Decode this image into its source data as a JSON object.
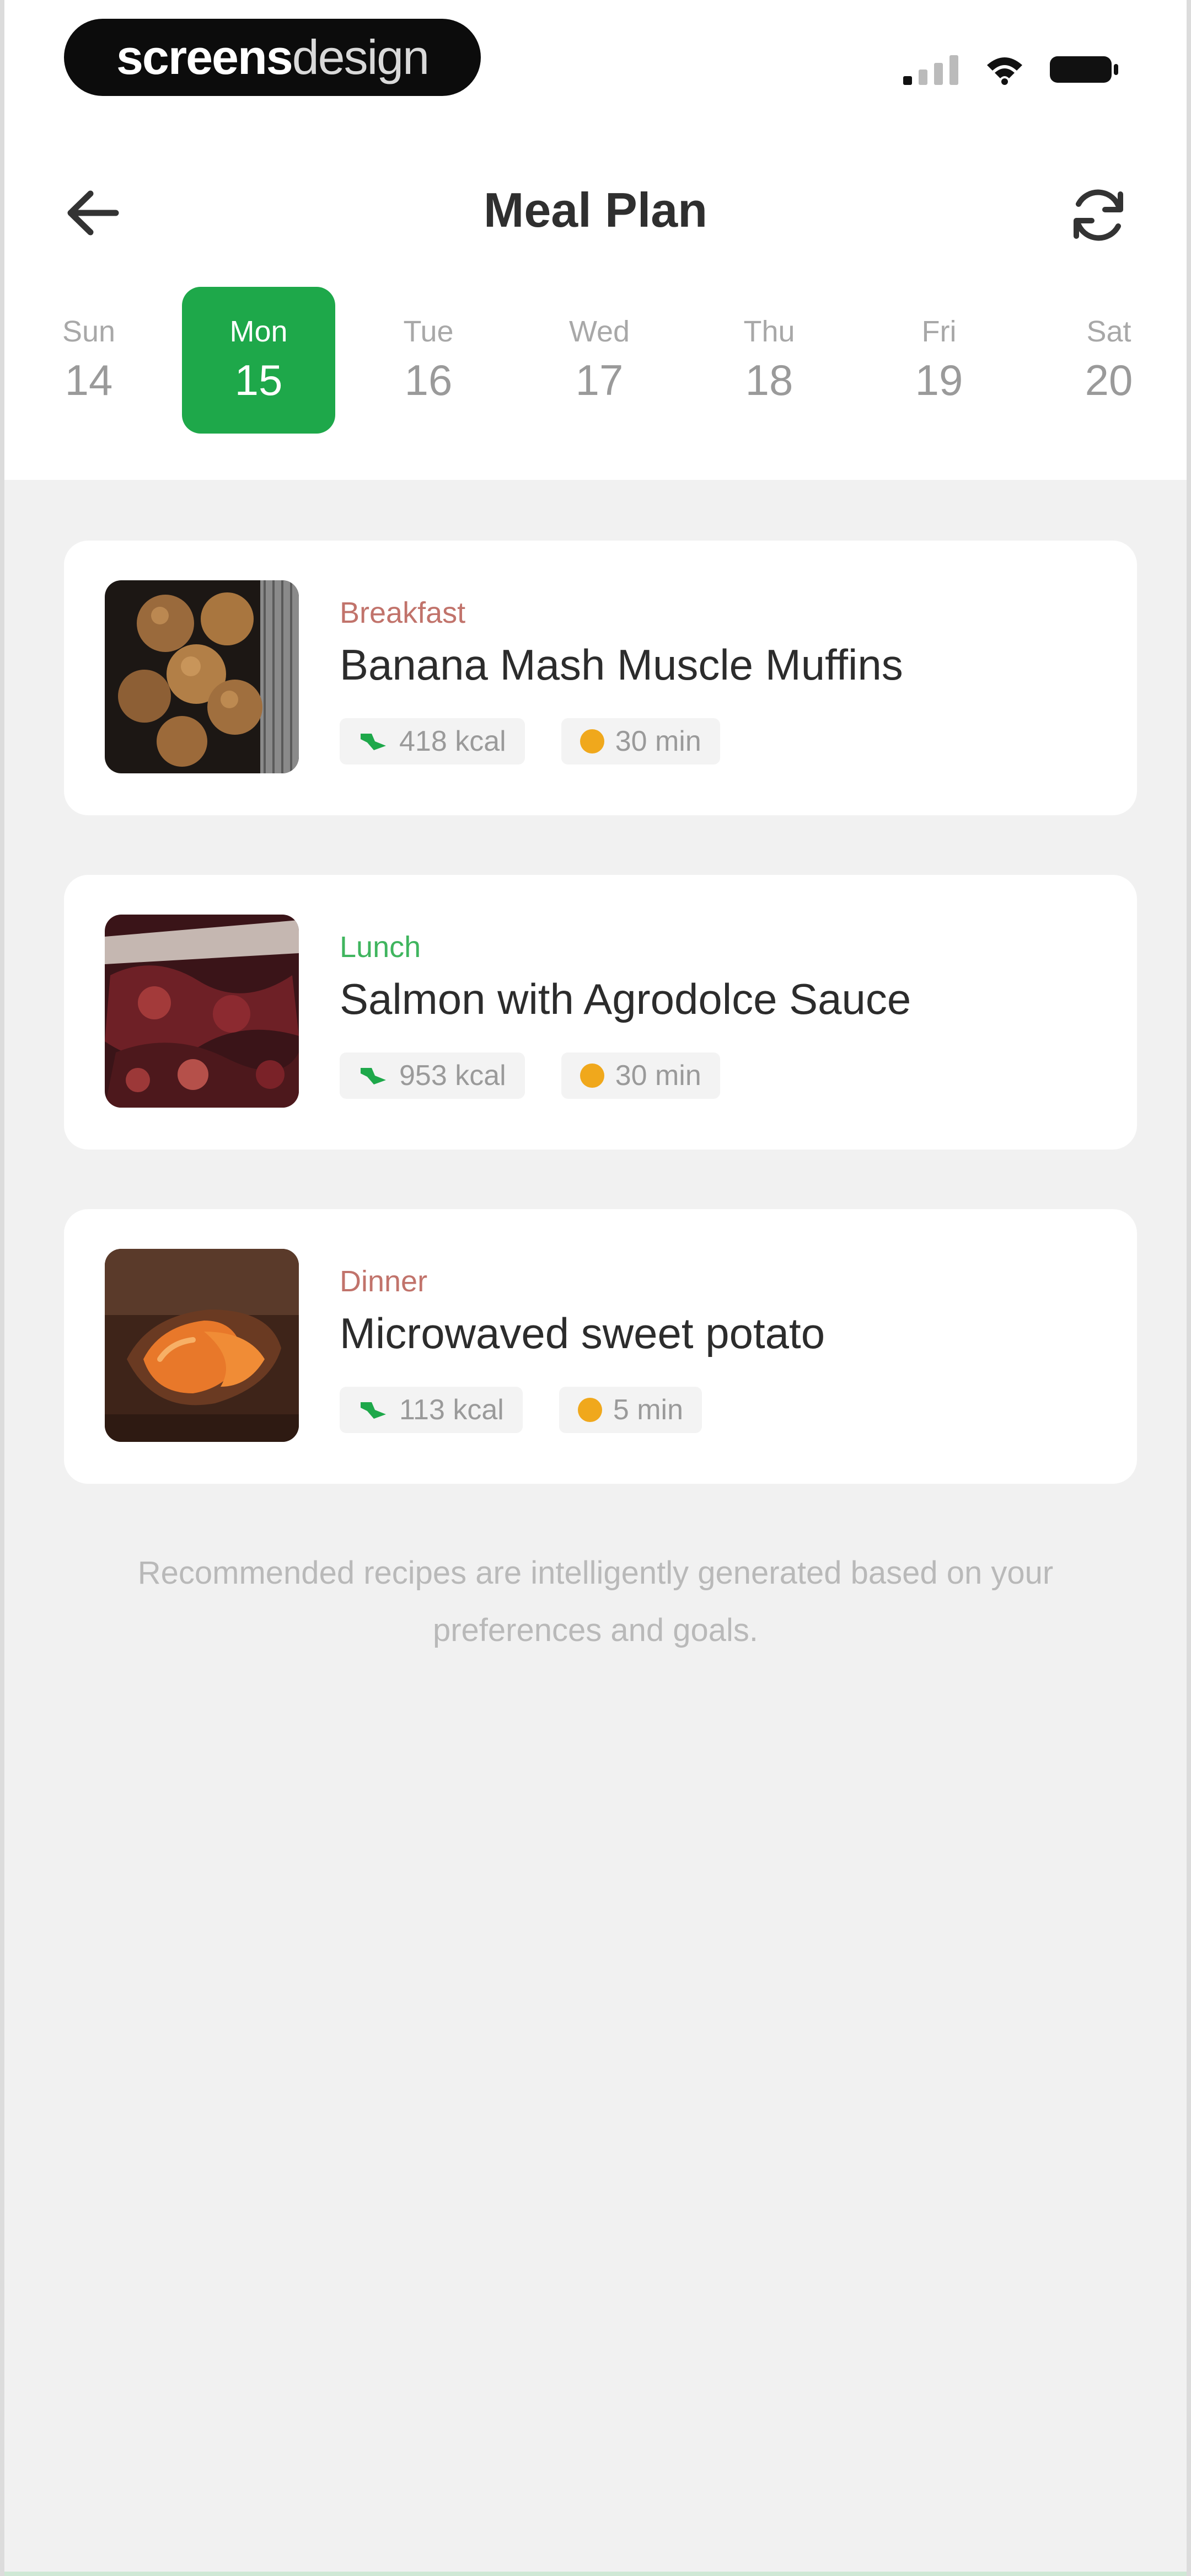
{
  "status_bar": {
    "brand_bold": "screens",
    "brand_light": "design",
    "icons": [
      "cellular-signal-icon",
      "wifi-icon",
      "battery-icon"
    ]
  },
  "header": {
    "title": "Meal Plan",
    "back_icon": "arrow-left-icon",
    "refresh_icon": "refresh-icon"
  },
  "days": [
    {
      "name": "Sun",
      "num": "14",
      "selected": false
    },
    {
      "name": "Mon",
      "num": "15",
      "selected": true
    },
    {
      "name": "Tue",
      "num": "16",
      "selected": false
    },
    {
      "name": "Wed",
      "num": "17",
      "selected": false
    },
    {
      "name": "Thu",
      "num": "18",
      "selected": false
    },
    {
      "name": "Fri",
      "num": "19",
      "selected": false
    },
    {
      "name": "Sat",
      "num": "20",
      "selected": false
    }
  ],
  "meals": [
    {
      "type": "Breakfast",
      "type_color": "#c1736b",
      "name": "Banana Mash Muscle Muffins",
      "kcal": "418 kcal",
      "time": "30 min",
      "image": "muffins-photo"
    },
    {
      "type": "Lunch",
      "type_color": "#3fb55e",
      "name": "Salmon with Agrodolce Sauce",
      "kcal": "953 kcal",
      "time": "30 min",
      "image": "salmon-photo"
    },
    {
      "type": "Dinner",
      "type_color": "#c1736b",
      "name": "Microwaved sweet potato",
      "kcal": "113 kcal",
      "time": "5 min",
      "image": "sweet-potato-photo"
    }
  ],
  "footnote": "Recommended recipes are intelligently generated based on your preferences and goals.",
  "colors": {
    "accent": "#1ea84a",
    "background": "#f1f1f1",
    "card": "#ffffff",
    "time_dot": "#f0a81c"
  }
}
